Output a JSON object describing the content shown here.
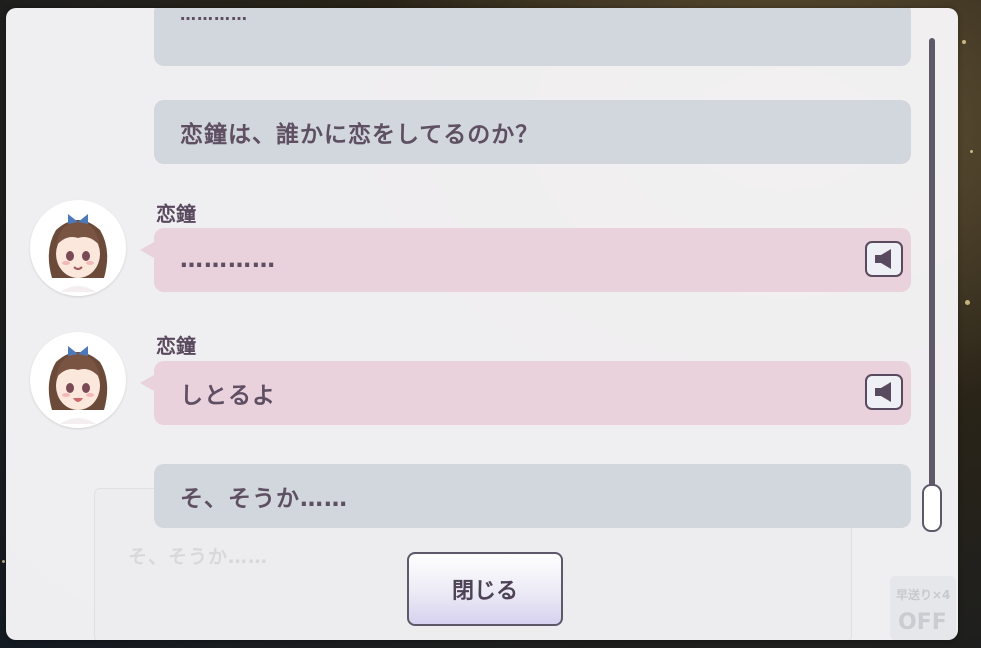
{
  "log": {
    "entries": [
      {
        "type": "self",
        "text": "…………"
      },
      {
        "type": "self",
        "text": "恋鐘は、誰かに恋をしてるのか？"
      },
      {
        "type": "other",
        "speaker": "恋鐘",
        "text": "…………",
        "icon": "speaker-icon"
      },
      {
        "type": "other",
        "speaker": "恋鐘",
        "text": "しとるよ",
        "icon": "speaker-icon"
      },
      {
        "type": "self",
        "text": "そ、そうか……"
      }
    ]
  },
  "background": {
    "message_text": "そ、そうか……",
    "speed_label": "早送り×4",
    "auto_state": "OFF"
  },
  "buttons": {
    "close_label": "閉じる"
  },
  "colors": {
    "self_bubble": "#d2d7dd",
    "other_bubble": "#ead2dd",
    "text": "#5e4f63",
    "scrollbar": "#5e5868"
  }
}
